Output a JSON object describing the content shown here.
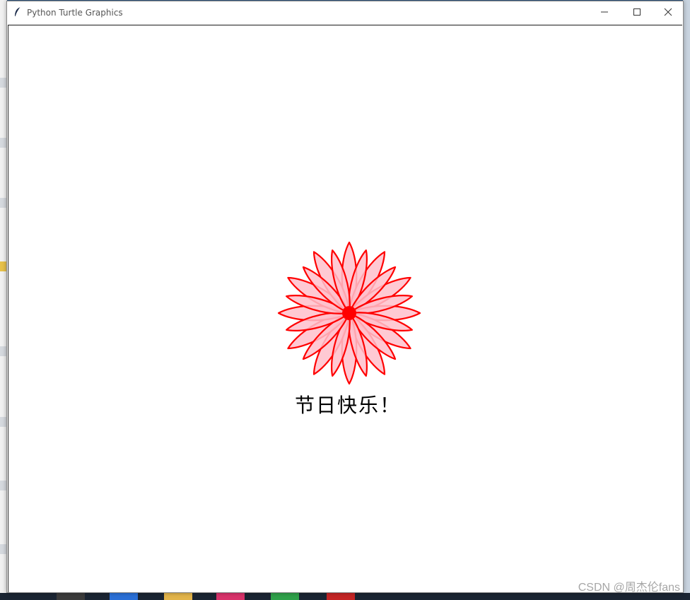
{
  "window": {
    "title": "Python Turtle Graphics",
    "icon": "feather-icon",
    "controls": {
      "minimize_icon": "minimize-icon",
      "maximize_icon": "maximize-icon",
      "close_icon": "close-icon"
    }
  },
  "canvas": {
    "background": "#ffffff",
    "drawing": {
      "shape": "flower",
      "petal_count": 12,
      "petal_layers": 2,
      "stroke_color": "#ff0000",
      "fill_color": "#ffc0cb"
    },
    "greeting_text": "节日快乐！"
  },
  "watermark": {
    "text": "CSDN @周杰伦fans"
  },
  "colors": {
    "desktop": "#2a4f7a",
    "window_bg": "#ffffff",
    "title_text": "#555555"
  }
}
